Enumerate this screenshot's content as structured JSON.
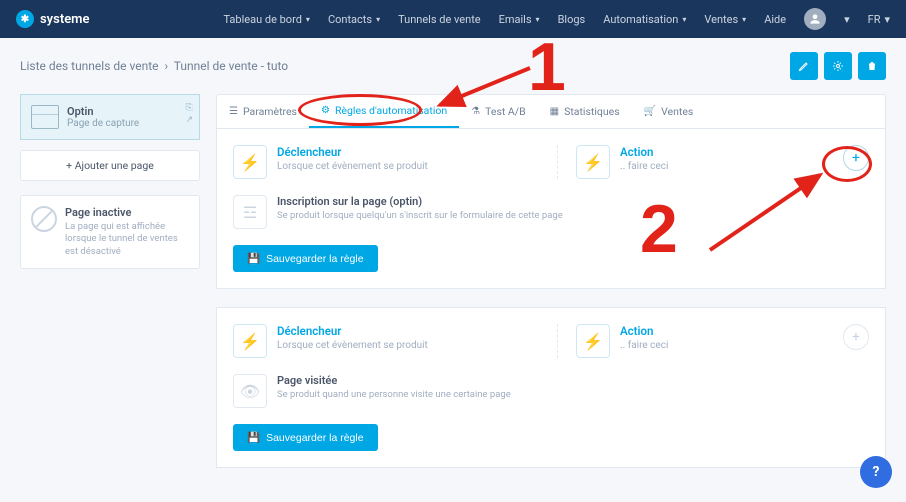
{
  "brand": "systeme",
  "nav": {
    "dashboard": "Tableau de bord",
    "contacts": "Contacts",
    "funnels": "Tunnels de vente",
    "emails": "Emails",
    "blogs": "Blogs",
    "automation": "Automatisation",
    "sales": "Ventes",
    "help": "Aide",
    "lang": "FR"
  },
  "breadcrumb": {
    "root": "Liste des tunnels de vente",
    "current": "Tunnel de vente - tuto"
  },
  "sidebar": {
    "optin": {
      "title": "Optin",
      "subtitle": "Page de capture"
    },
    "add_page": "+  Ajouter une page",
    "inactive": {
      "title": "Page inactive",
      "text": "La page qui est affichée lorsque le tunnel de ventes est désactivé"
    }
  },
  "tabs": {
    "params": "Paramètres",
    "rules": "Règles d'automatisation",
    "test": "Test A/B",
    "stats": "Statistiques",
    "sales": "Ventes"
  },
  "rule": {
    "trigger": "Déclencheur",
    "trigger_sub": "Lorsque cet évènement se produit",
    "action": "Action",
    "action_sub": ".. faire ceci",
    "save": "Sauvegarder la règle"
  },
  "events": {
    "signup": {
      "title": "Inscription sur la page (optin)",
      "sub": "Se produit lorsque quelqu'un s'inscrit sur le formulaire de cette page"
    },
    "visit": {
      "title": "Page visitée",
      "sub": "Se produit quand une personne visite une certaine page"
    }
  },
  "annotations": {
    "one": "1",
    "two": "2"
  },
  "help_fab": "?"
}
